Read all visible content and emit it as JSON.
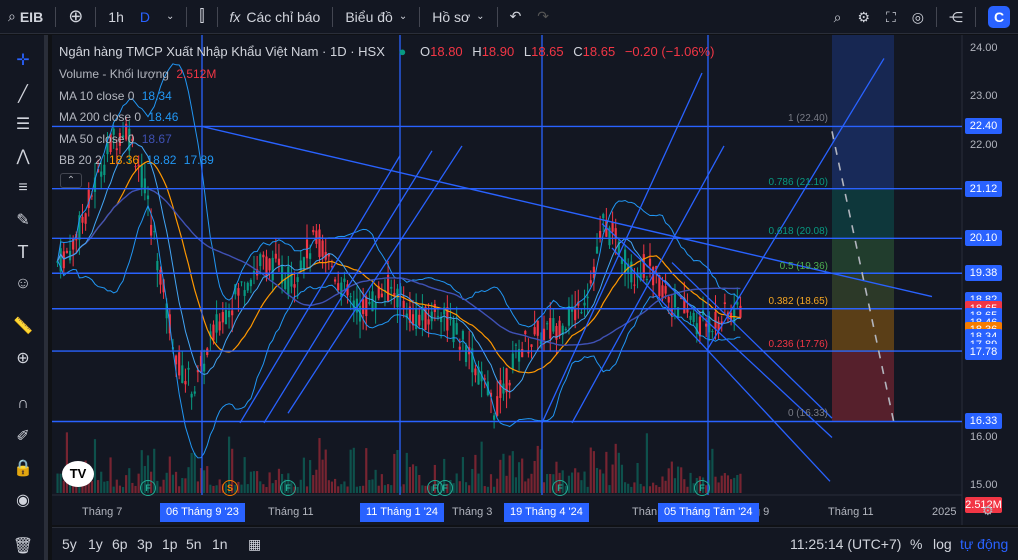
{
  "topbar": {
    "symbol": "EIB",
    "interval": "1h",
    "interval_d": "D",
    "indicators": "Các chỉ báo",
    "chart_type": "Biểu đồ",
    "profile": "Hồ sơ"
  },
  "legend": {
    "title": "Ngân hàng TMCP Xuất Nhập Khẩu Việt Nam · 1D · HSX",
    "o_label": "O",
    "o": "18.80",
    "h_label": "H",
    "h": "18.90",
    "l_label": "L",
    "l": "18.65",
    "c_label": "C",
    "c": "18.65",
    "change": "−0.20 (−1.06%)",
    "volume_label": "Volume - Khối lượng",
    "volume": "2.512M",
    "ma10_label": "MA 10 close 0",
    "ma10": "18.34",
    "ma200_label": "MA 200 close 0",
    "ma200": "18.46",
    "ma50_label": "MA 50 close 0",
    "ma50": "18.67",
    "bb_label": "BB 20 2",
    "bb1": "18.36",
    "bb2": "18.82",
    "bb3": "17.89"
  },
  "yaxis": {
    "ticks": [
      "24.00",
      "23.00",
      "22.00",
      "16.00",
      "15.00"
    ],
    "badges": [
      {
        "v": "22.40",
        "c": "#2962ff"
      },
      {
        "v": "21.12",
        "c": "#2962ff"
      },
      {
        "v": "20.10",
        "c": "#2962ff"
      },
      {
        "v": "19.38",
        "c": "#2962ff"
      },
      {
        "v": "18.82",
        "c": "#2962ff"
      },
      {
        "v": "18.67",
        "c": "#2962ff"
      },
      {
        "v": "18.65",
        "c": "#f23645"
      },
      {
        "v": "18.65",
        "c": "#2962ff"
      },
      {
        "v": "18.46",
        "c": "#2962ff"
      },
      {
        "v": "18.36",
        "c": "#f57c00"
      },
      {
        "v": "18.34",
        "c": "#2962ff"
      },
      {
        "v": "17.89",
        "c": "#2962ff"
      },
      {
        "v": "17.78",
        "c": "#2962ff"
      },
      {
        "v": "16.33",
        "c": "#2962ff"
      },
      {
        "v": "2.512M",
        "c": "#f23645"
      }
    ]
  },
  "xaxis": {
    "ticks": [
      "Tháng 7",
      "Tháng 11",
      "Tháng 3",
      "Thán",
      "g 9",
      "Tháng 11",
      "2025"
    ],
    "badges": [
      "06 Tháng 9 '23",
      "11 Tháng 1 '24",
      "19 Tháng 4 '24",
      "05 Tháng Tám '24"
    ]
  },
  "fib": [
    {
      "t": "1 (22.40)",
      "c": "#787b86"
    },
    {
      "t": "0.786 (21.10)",
      "c": "#089981"
    },
    {
      "t": "0.618 (20.08)",
      "c": "#089981"
    },
    {
      "t": "0.5 (19.36)",
      "c": "#4caf50"
    },
    {
      "t": "0.382 (18.65)",
      "c": "#f5a623"
    },
    {
      "t": "0.236 (17.76)",
      "c": "#f23645"
    },
    {
      "t": "0 (16.33)",
      "c": "#787b86"
    }
  ],
  "events": [
    "F",
    "S",
    "F",
    "F",
    "F",
    "F",
    "F"
  ],
  "bottombar": {
    "ranges": [
      "5y",
      "1y",
      "6p",
      "3p",
      "1p",
      "5n",
      "1n"
    ],
    "time": "11:25:14 (UTC+7)",
    "percent": "%",
    "log": "log",
    "auto": "tự động"
  },
  "chart_data": {
    "type": "candlestick",
    "symbol": "EIB",
    "interval": "1D",
    "ohlc_last": {
      "open": 18.8,
      "high": 18.9,
      "low": 18.65,
      "close": 18.65
    },
    "ylim": [
      14.9,
      24.2
    ],
    "price_path": [
      19.6,
      19.9,
      20.6,
      21.4,
      22.1,
      22.4,
      21.6,
      20.2,
      18.6,
      17.4,
      17.0,
      17.8,
      18.5,
      18.9,
      19.3,
      19.6,
      19.5,
      19.2,
      19.7,
      20.1,
      19.6,
      19.0,
      18.6,
      18.8,
      19.1,
      18.9,
      18.5,
      18.4,
      18.7,
      18.2,
      17.8,
      17.2,
      16.6,
      17.3,
      17.9,
      18.1,
      18.2,
      18.4,
      18.6,
      19.2,
      20.4,
      20.0,
      19.4,
      19.5,
      19.2,
      18.8,
      18.6,
      18.3,
      18.4,
      18.5,
      18.65
    ],
    "fib_levels": [
      22.4,
      21.1,
      20.08,
      19.36,
      18.65,
      17.76,
      16.33
    ]
  }
}
